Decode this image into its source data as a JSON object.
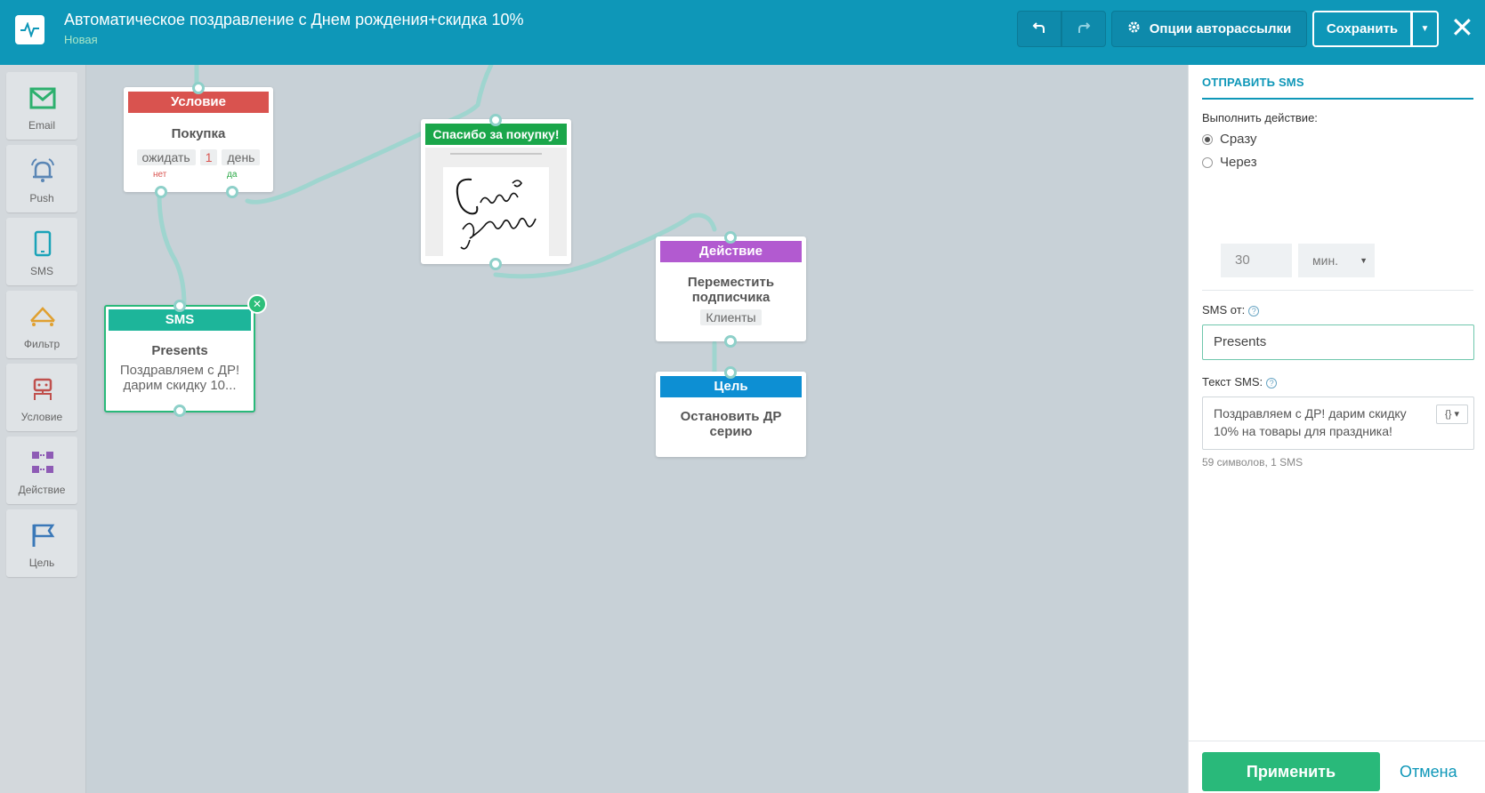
{
  "header": {
    "title": "Автоматическое поздравление с Днем рождения+скидка 10%",
    "status": "Новая",
    "options_label": "Опции авторассылки",
    "save_label": "Сохранить"
  },
  "palette": [
    {
      "label": "Email",
      "icon": "envelope-icon"
    },
    {
      "label": "Push",
      "icon": "bell-icon"
    },
    {
      "label": "SMS",
      "icon": "phone-icon"
    },
    {
      "label": "Фильтр",
      "icon": "filter-icon"
    },
    {
      "label": "Условие",
      "icon": "condition-icon"
    },
    {
      "label": "Действие",
      "icon": "action-icon"
    },
    {
      "label": "Цель",
      "icon": "flag-icon"
    }
  ],
  "nodes": {
    "condition": {
      "header": "Условие",
      "title": "Покупка",
      "wait": "ожидать",
      "num": "1",
      "unit": "день",
      "no": "нет",
      "yes": "да"
    },
    "email": {
      "header": "Спасибо за покупку!"
    },
    "action": {
      "header": "Действие",
      "title_line1": "Переместить",
      "title_line2": "подписчика",
      "tag": "Клиенты"
    },
    "goal": {
      "header": "Цель",
      "title_line1": "Остановить ДР",
      "title_line2": "серию"
    },
    "sms": {
      "header": "SMS",
      "title": "Presents",
      "desc_line1": "Поздравляем с ДР!",
      "desc_line2": "дарим скидку 10..."
    }
  },
  "panel": {
    "title": "ОТПРАВИТЬ SMS",
    "exec_label": "Выполнить действие:",
    "opt_now": "Сразу",
    "opt_later": "Через",
    "delay_value": "30",
    "delay_unit": "мин.",
    "from_label": "SMS от:",
    "from_value": "Presents",
    "text_label": "Текст SMS:",
    "text_value": "Поздравляем с ДР! дарим скидку 10% на товары для праздника!",
    "var_btn": "{}",
    "counter": "59 символов, 1 SMS",
    "apply": "Применить",
    "cancel": "Отмена"
  },
  "colors": {
    "header": "#0e97b8",
    "condition": "#d9534f",
    "email": "#1aa64a",
    "action": "#b25ad0",
    "goal": "#0d8fd3",
    "sms": "#1db59a",
    "apply": "#29b97a"
  }
}
